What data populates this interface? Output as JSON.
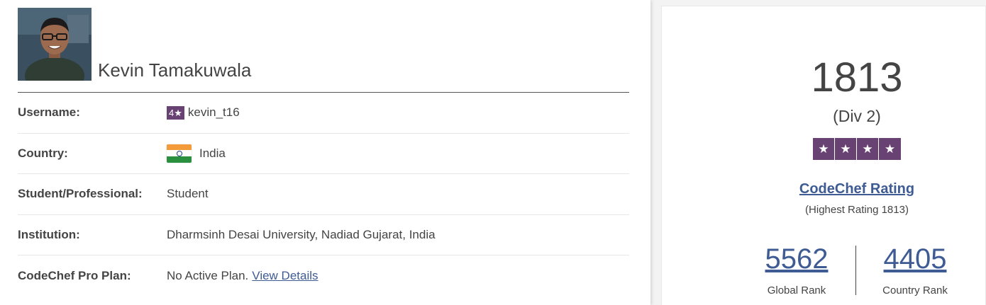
{
  "profile": {
    "name": "Kevin Tamakuwala"
  },
  "details": [
    {
      "label": "Username:",
      "badge": "4★",
      "value": "kevin_t16"
    },
    {
      "label": "Country:",
      "value": "India",
      "flag": "india-flag"
    },
    {
      "label": "Student/Professional:",
      "value": "Student"
    },
    {
      "label": "Institution:",
      "value": "Dharmsinh Desai University, Nadiad Gujarat, India"
    },
    {
      "label": "CodeChef Pro Plan:",
      "value": "No Active Plan.",
      "link": "View Details"
    }
  ],
  "rating": {
    "number": "1813",
    "division": "(Div 2)",
    "stars": [
      "★",
      "★",
      "★",
      "★"
    ],
    "title": "CodeChef Rating",
    "highest": "(Highest Rating 1813)"
  },
  "ranks": {
    "global_value": "5562",
    "global_label": "Global Rank",
    "country_value": "4405",
    "country_label": "Country Rank"
  },
  "colors": {
    "star_purple": "#684273",
    "link_blue": "#3e5b94"
  }
}
